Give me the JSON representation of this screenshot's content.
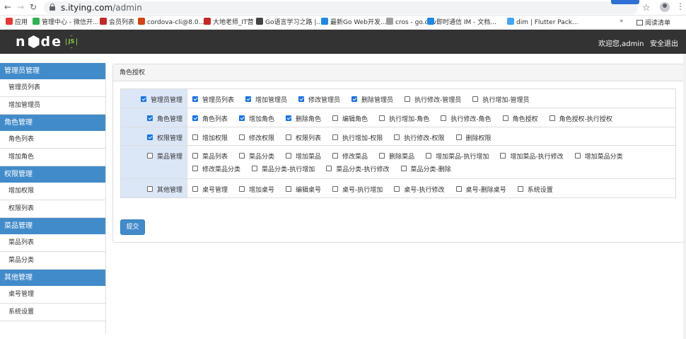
{
  "browser": {
    "url_host": "s.itying.com",
    "url_path": "/admin",
    "bookmarks": [
      {
        "label": "应用",
        "icon_color": "#e53935"
      },
      {
        "label": "管理中心 - 微信开...",
        "icon_color": "#2bb24c"
      },
      {
        "label": "会员列表",
        "icon_color": "#c62828"
      },
      {
        "label": "cordova-cli@8.0...",
        "icon_color": "#d84315"
      },
      {
        "label": "大地老师_IT营",
        "icon_color": "#c62828"
      },
      {
        "label": "Go语言学习之路 |...",
        "icon_color": "#424242"
      },
      {
        "label": "最新Go Web开发...",
        "icon_color": "#1e88e5"
      },
      {
        "label": "cros - go.dev",
        "icon_color": "#9e9e9e"
      },
      {
        "label": "即时通信 IM - 文档...",
        "icon_color": "#1e88e5"
      },
      {
        "label": "dim | Flutter Pack...",
        "icon_color": "#42a5f5"
      }
    ],
    "bookmarks_more": "»",
    "reading_list": "阅读清单"
  },
  "header": {
    "logo_text_left": "n",
    "logo_text_mid": "d",
    "logo_text_right": "e",
    "logo_badge": "JS",
    "welcome": "欢迎您,admin",
    "logout": "安全退出"
  },
  "sidebar": [
    {
      "title": "管理员管理",
      "items": [
        "管理员列表",
        "增加管理员"
      ]
    },
    {
      "title": "角色管理",
      "items": [
        "角色列表",
        "增加角色"
      ]
    },
    {
      "title": "权限管理",
      "items": [
        "增加权限",
        "权限列表"
      ]
    },
    {
      "title": "菜品管理",
      "items": [
        "菜品列表",
        "菜品分类"
      ]
    },
    {
      "title": "其他管理",
      "items": [
        "桌号管理",
        "系统设置"
      ]
    }
  ],
  "panel": {
    "title": "角色授权",
    "submit_label": "提交",
    "groups": [
      {
        "name": "管理员管理",
        "checked": true,
        "perms": [
          {
            "label": "管理员列表",
            "checked": true
          },
          {
            "label": "增加管理员",
            "checked": true
          },
          {
            "label": "修改管理员",
            "checked": true
          },
          {
            "label": "删除管理员",
            "checked": true
          },
          {
            "label": "执行修改-管理员",
            "checked": false
          },
          {
            "label": "执行增加-管理员",
            "checked": false
          }
        ]
      },
      {
        "name": "角色管理",
        "checked": true,
        "perms": [
          {
            "label": "角色列表",
            "checked": true
          },
          {
            "label": "增加角色",
            "checked": true
          },
          {
            "label": "删除角色",
            "checked": true
          },
          {
            "label": "编辑角色",
            "checked": false
          },
          {
            "label": "执行增加-角色",
            "checked": false
          },
          {
            "label": "执行修改-角色",
            "checked": false
          },
          {
            "label": "角色授权",
            "checked": false
          },
          {
            "label": "角色授权-执行授权",
            "checked": false
          }
        ]
      },
      {
        "name": "权限管理",
        "checked": true,
        "perms": [
          {
            "label": "增加权限",
            "checked": false
          },
          {
            "label": "修改权限",
            "checked": false
          },
          {
            "label": "权限列表",
            "checked": false
          },
          {
            "label": "执行增加-权限",
            "checked": false
          },
          {
            "label": "执行修改-权限",
            "checked": false
          },
          {
            "label": "删除权限",
            "checked": false
          }
        ]
      },
      {
        "name": "菜品管理",
        "checked": false,
        "perms": [
          {
            "label": "菜品列表",
            "checked": false
          },
          {
            "label": "菜品分类",
            "checked": false
          },
          {
            "label": "增加菜品",
            "checked": false
          },
          {
            "label": "修改菜品",
            "checked": false
          },
          {
            "label": "删除菜品",
            "checked": false
          },
          {
            "label": "增加菜品-执行增加",
            "checked": false
          },
          {
            "label": "增加菜品-执行修改",
            "checked": false
          },
          {
            "label": "增加菜品分类",
            "checked": false
          },
          {
            "label": "修改菜品分类",
            "checked": false
          },
          {
            "label": "菜品分类-执行增加",
            "checked": false
          },
          {
            "label": "菜品分类-执行修改",
            "checked": false
          },
          {
            "label": "菜品分类-删除",
            "checked": false
          }
        ]
      },
      {
        "name": "其他管理",
        "checked": false,
        "perms": [
          {
            "label": "桌号管理",
            "checked": false
          },
          {
            "label": "增加桌号",
            "checked": false
          },
          {
            "label": "编辑桌号",
            "checked": false
          },
          {
            "label": "桌号-执行增加",
            "checked": false
          },
          {
            "label": "桌号-执行修改",
            "checked": false
          },
          {
            "label": "桌号-删除桌号",
            "checked": false
          },
          {
            "label": "系统设置",
            "checked": false
          }
        ]
      }
    ]
  }
}
